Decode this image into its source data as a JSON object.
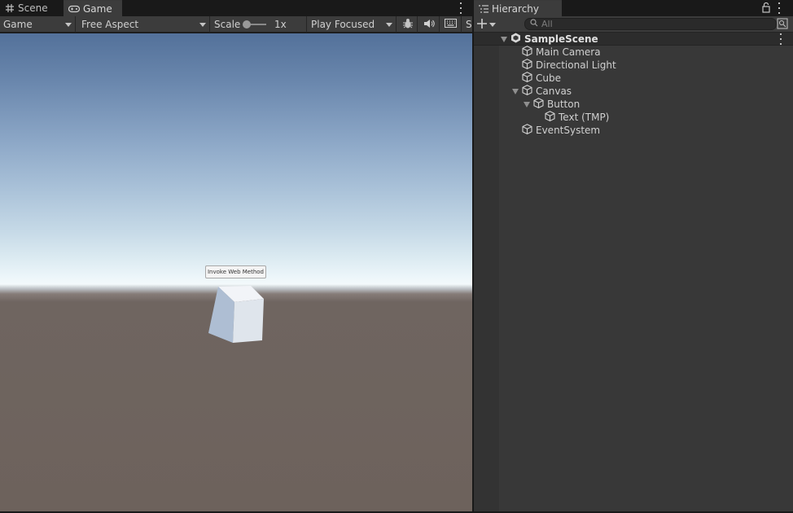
{
  "tabs": {
    "scene": "Scene",
    "game": "Game",
    "hierarchy": "Hierarchy"
  },
  "game_toolbar": {
    "display": "Game",
    "aspect": "Free Aspect",
    "scale_label": "Scale",
    "scale_value": "1x",
    "play_mode": "Play Focused",
    "stats_partial": "S"
  },
  "viewport": {
    "ui_button_label": "Invoke Web Method"
  },
  "hierarchy": {
    "search_placeholder": "All",
    "scene_name": "SampleScene",
    "items": [
      {
        "label": "Main Camera"
      },
      {
        "label": "Directional Light"
      },
      {
        "label": "Cube"
      },
      {
        "label": "Canvas"
      },
      {
        "label": "Button"
      },
      {
        "label": "Text (TMP)"
      },
      {
        "label": "EventSystem"
      }
    ]
  },
  "colors": {
    "panel_bg": "#383838",
    "toolbar_bg": "#3c3c3c",
    "sky_top": "#53719a",
    "horizon": "#f3f9fb",
    "ground": "#6d625c"
  }
}
